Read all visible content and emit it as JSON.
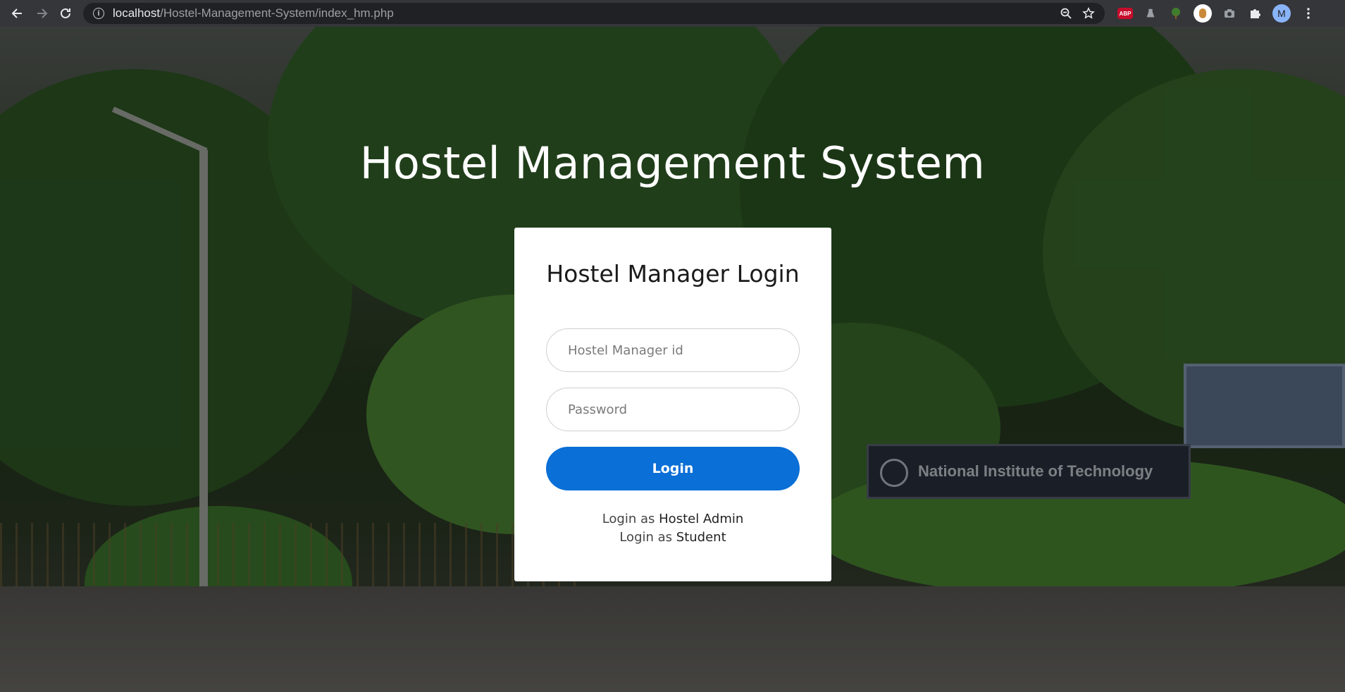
{
  "browser": {
    "url_host": "localhost",
    "url_path": "/Hostel-Management-System/index_hm.php",
    "profile_initial": "M",
    "extensions": [
      "abp-extension-icon",
      "flask-extension-icon",
      "tree-extension-icon",
      "circle-extension-icon",
      "camera-extension-icon",
      "puzzle-icon"
    ],
    "abp_label": "ABP"
  },
  "background": {
    "sign_text": "National Institute of Technology"
  },
  "page": {
    "title": "Hostel Management System"
  },
  "login_card": {
    "title": "Hostel Manager Login",
    "id_placeholder": "Hostel Manager id",
    "password_placeholder": "Password",
    "submit_label": "Login",
    "link_prefix": "Login as",
    "admin_link": "Hostel Admin",
    "student_link": "Student"
  },
  "colors": {
    "primary_button": "#0a6fd6",
    "card_background": "#ffffff"
  }
}
